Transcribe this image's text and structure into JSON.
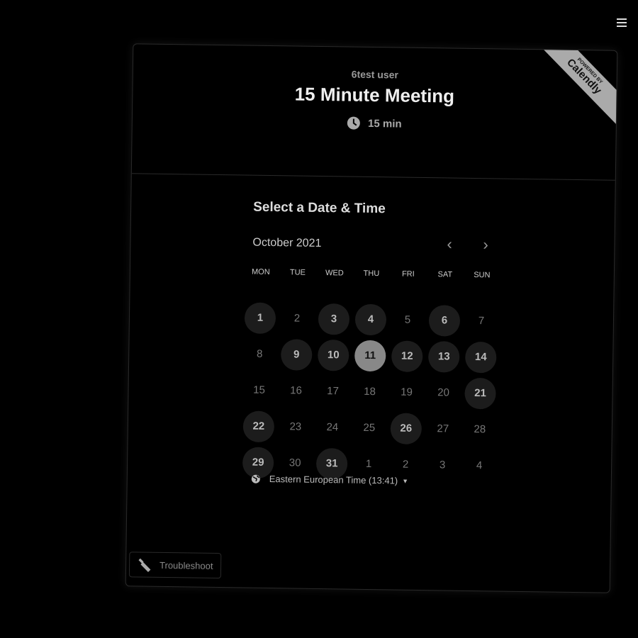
{
  "header": {
    "user": "6test user",
    "title": "15 Minute Meeting",
    "duration": "15 min",
    "badge_top": "POWERED BY",
    "badge_brand": "Calendly"
  },
  "calendar": {
    "heading": "Select a Date & Time",
    "month": "October 2021",
    "weekdays": [
      "MON",
      "TUE",
      "WED",
      "THU",
      "FRI",
      "SAT",
      "SUN"
    ],
    "days": [
      {
        "d": "1",
        "s": "available"
      },
      {
        "d": "2",
        "s": "off"
      },
      {
        "d": "3",
        "s": "available"
      },
      {
        "d": "4",
        "s": "available"
      },
      {
        "d": "5",
        "s": "off"
      },
      {
        "d": "6",
        "s": "available"
      },
      {
        "d": "7",
        "s": "off"
      },
      {
        "d": "8",
        "s": "off"
      },
      {
        "d": "9",
        "s": "available"
      },
      {
        "d": "10",
        "s": "available"
      },
      {
        "d": "11",
        "s": "selected"
      },
      {
        "d": "12",
        "s": "available"
      },
      {
        "d": "13",
        "s": "available"
      },
      {
        "d": "14",
        "s": "available"
      },
      {
        "d": "15",
        "s": "off"
      },
      {
        "d": "16",
        "s": "off"
      },
      {
        "d": "17",
        "s": "off"
      },
      {
        "d": "18",
        "s": "off"
      },
      {
        "d": "19",
        "s": "off"
      },
      {
        "d": "20",
        "s": "off"
      },
      {
        "d": "21",
        "s": "available"
      },
      {
        "d": "22",
        "s": "available"
      },
      {
        "d": "23",
        "s": "off"
      },
      {
        "d": "24",
        "s": "off"
      },
      {
        "d": "25",
        "s": "off"
      },
      {
        "d": "26",
        "s": "available"
      },
      {
        "d": "27",
        "s": "off"
      },
      {
        "d": "28",
        "s": "off"
      },
      {
        "d": "29",
        "s": "available"
      },
      {
        "d": "30",
        "s": "off"
      },
      {
        "d": "31",
        "s": "available"
      },
      {
        "d": "1",
        "s": "off"
      },
      {
        "d": "2",
        "s": "off"
      },
      {
        "d": "3",
        "s": "off"
      },
      {
        "d": "4",
        "s": "off"
      }
    ],
    "timezone": "Eastern European Time (13:41)"
  },
  "troubleshoot": "Troubleshoot"
}
